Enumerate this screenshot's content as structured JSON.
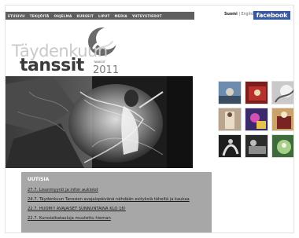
{
  "nav": {
    "items": [
      {
        "label": "ETUSIVU"
      },
      {
        "label": "TEKIJÖITÄ"
      },
      {
        "label": "OHJELMA"
      },
      {
        "label": "KURSSIT"
      },
      {
        "label": "LIPUT"
      },
      {
        "label": "MEDIA"
      },
      {
        "label": "YHTEYSTIEDOT"
      }
    ]
  },
  "language": {
    "active": "Suomi",
    "separator": " | ",
    "other": "English"
  },
  "facebook": {
    "label": "facebook"
  },
  "logo": {
    "line1": "Täydenkuun",
    "line2": "tanssit",
    "tagline": "TANSSIT",
    "year": "2011"
  },
  "news": {
    "heading": "UUTISIA",
    "items": [
      {
        "text": "27.7. Lisunmyynti ja infon aukiolot"
      },
      {
        "text": "24.7. Täydenkuun Tanssien avajaispäivänä nähdään esityksiä täheltä ja kaukaa"
      },
      {
        "text": "22.7. HUOM!! AVAJAISET SUNNUNTAINA KLO 16!"
      },
      {
        "text": "22.7. Kurssiaikatauluja muutettu hieman"
      }
    ]
  },
  "colors": {
    "nav_bg": "#5f5f5f",
    "news_bg": "#a7a7a7",
    "facebook": "#3b5998"
  }
}
